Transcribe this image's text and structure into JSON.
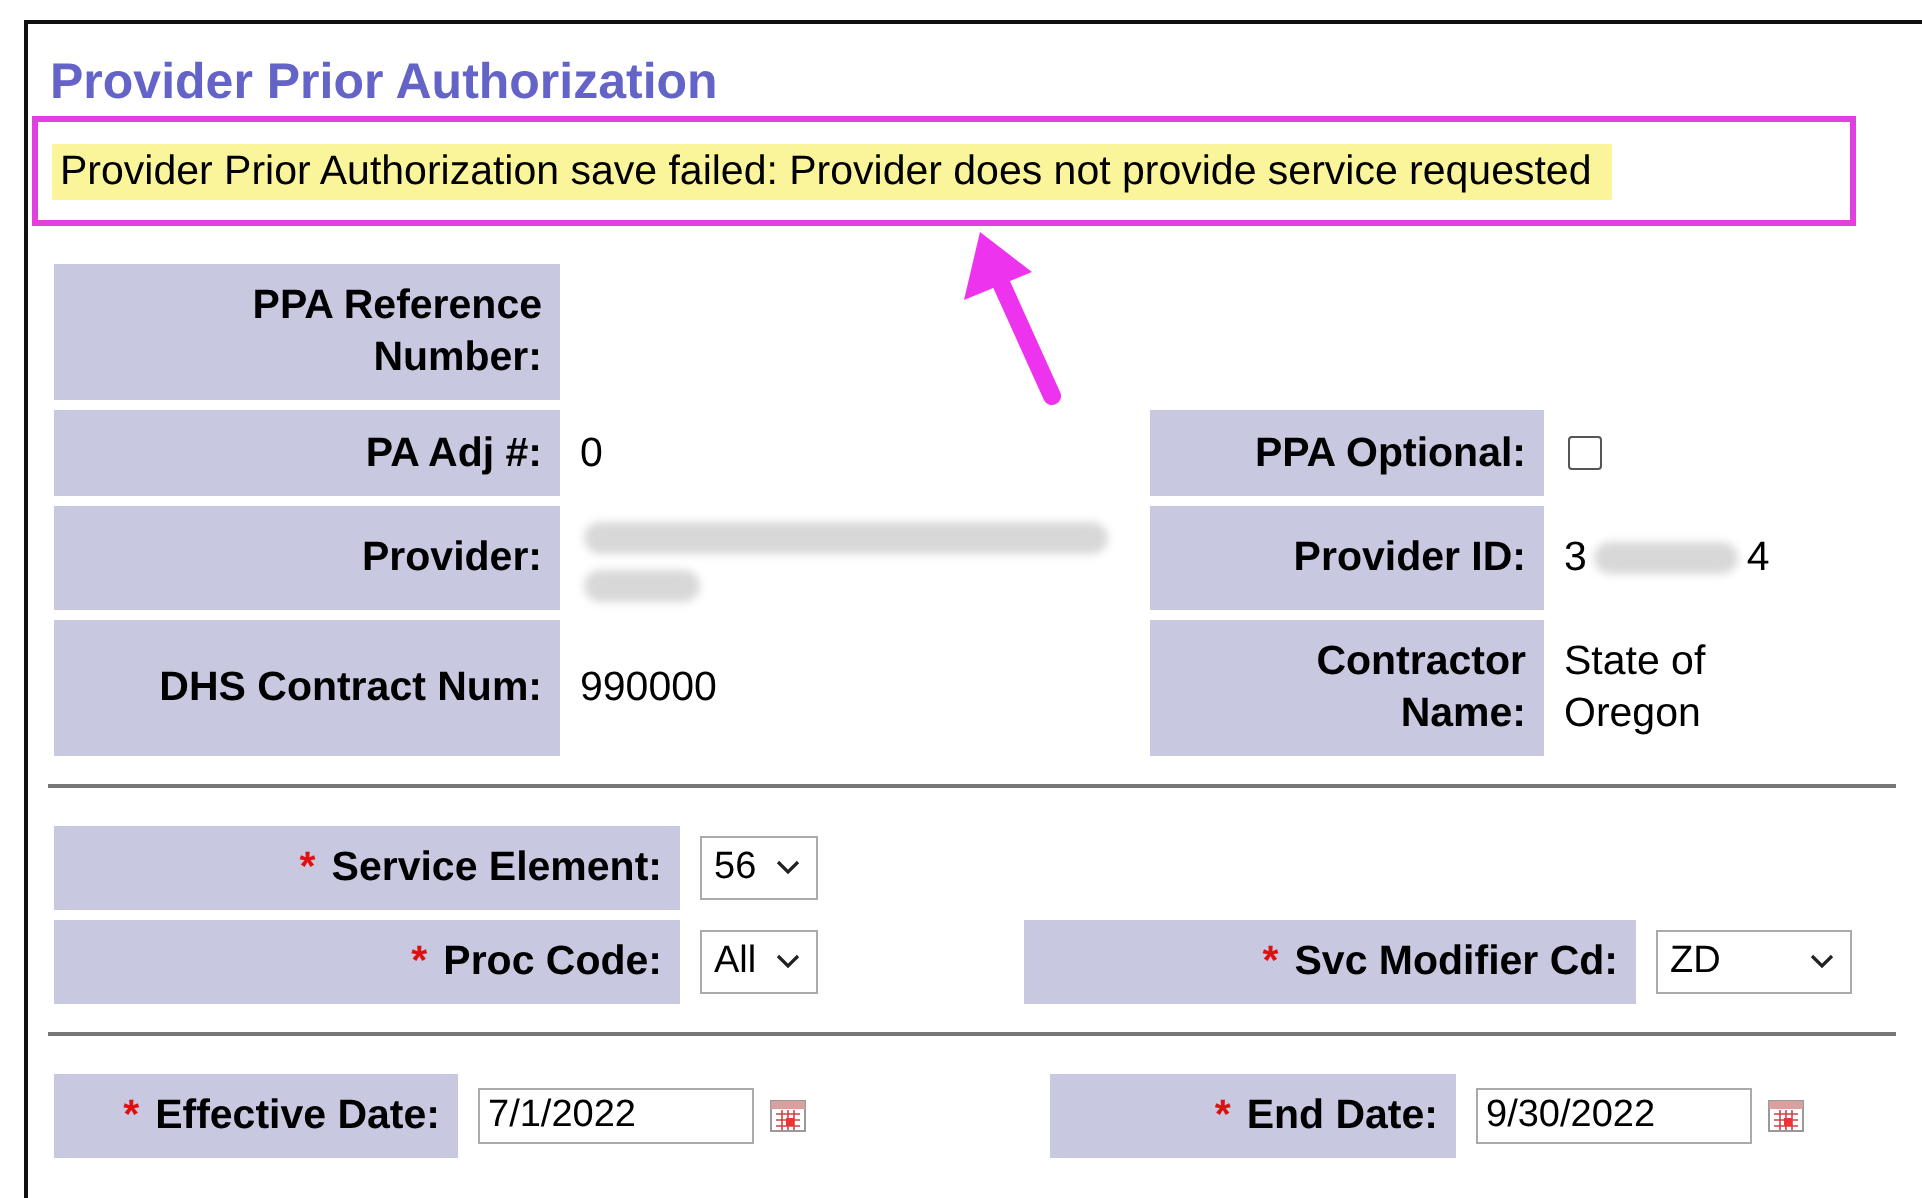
{
  "title": "Provider Prior Authorization",
  "error_message": "Provider Prior Authorization save failed: Provider does not provide service requested",
  "details": [
    {
      "cells": [
        {
          "label": "PPA Reference\nNumber:",
          "kind": "empty"
        }
      ]
    },
    {
      "cells": [
        {
          "label": "PA Adj #:",
          "kind": "text",
          "value": "0"
        },
        {
          "label": "PPA Optional:",
          "kind": "checkbox",
          "checked": false
        }
      ]
    },
    {
      "cells": [
        {
          "label": "Provider:",
          "kind": "blurred"
        },
        {
          "label": "Provider ID:",
          "kind": "masked",
          "value_start": "3",
          "value_end": "4"
        }
      ]
    },
    {
      "cells": [
        {
          "label": "DHS Contract Num:",
          "kind": "text",
          "value": "990000"
        },
        {
          "label": "Contractor\nName:",
          "kind": "text",
          "value": "State of\nOregon"
        }
      ]
    }
  ],
  "service": [
    {
      "cells": [
        {
          "label": "Service Element:",
          "required_mark": "*",
          "kind": "select",
          "value": "56"
        }
      ]
    },
    {
      "cells": [
        {
          "label": "Proc Code:",
          "required_mark": "*",
          "kind": "select",
          "value": "All"
        },
        {
          "label": "Svc Modifier Cd:",
          "required_mark": "*",
          "kind": "select",
          "value": "ZD"
        }
      ]
    }
  ],
  "dates": [
    {
      "cells": [
        {
          "label": "Effective Date:",
          "required_mark": "*",
          "kind": "date",
          "value": "7/1/2022"
        },
        {
          "label": "End Date:",
          "required_mark": "*",
          "kind": "date",
          "value": "9/30/2022"
        }
      ]
    }
  ]
}
